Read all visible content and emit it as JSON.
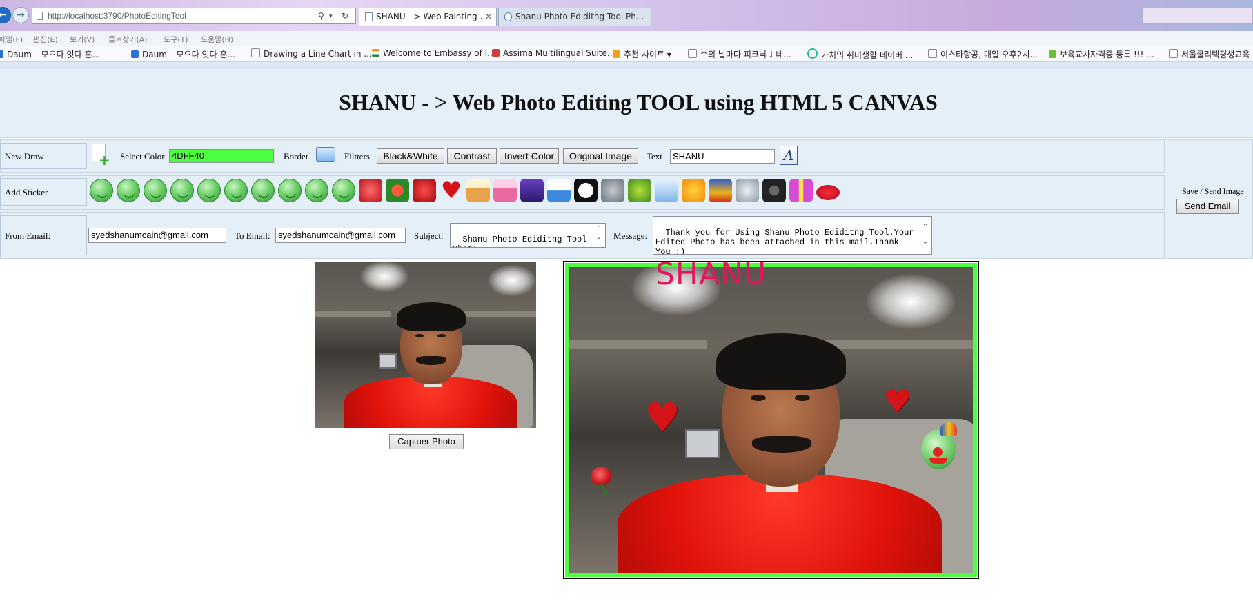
{
  "browser": {
    "address": "http://localhost:3790/PhotoEditingTool",
    "tabs": [
      {
        "label": "SHANU - > Web Painting ..."
      },
      {
        "label": "Shanu Photo Ediditng Tool Ph..."
      }
    ],
    "menu": [
      "파일(F)",
      "편집(E)",
      "보기(V)",
      "즐겨찾기(A)",
      "도구(T)",
      "도움말(H)"
    ],
    "favorites": [
      {
        "label": "Daum – 모으다 잇다 흔...",
        "icon_color": "#2f6fd6"
      },
      {
        "label": "Daum – 모으다 잇다 흔...",
        "icon_color": "#2f6fd6"
      },
      {
        "label": "Drawing a Line Chart in ...",
        "icon_color": "#8a8a8a"
      },
      {
        "label": "Welcome to Embassy of I...",
        "icon_color": "#f28c28"
      },
      {
        "label": "Assima Multilingual Suite...",
        "icon_color": "#d23b3b"
      },
      {
        "label": "추천 사이트 ▾",
        "icon_color": "#f0a020"
      },
      {
        "label": "수의 날마다 피크닉 ♩  네...",
        "icon_color": "#8a8a8a"
      },
      {
        "label": "가치의 취미생활  네이버 ...",
        "icon_color": "#1bbfa3"
      },
      {
        "label": "이스타항공, 매일 오후2시...",
        "icon_color": "#8a8a8a"
      },
      {
        "label": "보육교사자격증 등록 !!!  ...",
        "icon_color": "#6bbf3a"
      },
      {
        "label": "서울쿨리텍평생교육",
        "icon_color": "#8a8a8a"
      }
    ]
  },
  "page": {
    "title": "SHANU - > Web Photo Editing TOOL using HTML 5 CANVAS"
  },
  "toolbar": {
    "new_draw_label": "New Draw",
    "select_color_label": "Select Color",
    "color_value": "4DFF40",
    "selected_color": "#4dff40",
    "border_label": "Border",
    "filters_label": "Filtters",
    "filter_buttons": [
      "Black&White",
      "Contrast",
      "Invert Color",
      "Original Image"
    ],
    "text_label": "Text",
    "text_value": "SHANU",
    "add_sticker_label": "Add Sticker",
    "stickers": [
      "smiley-blush-icon",
      "smiley-love-icon",
      "smiley-party-icon",
      "smiley-kiss-icon",
      "smiley-tongue-icon",
      "smiley-pirate-icon",
      "smiley-grin-icon",
      "smiley-surprised-icon",
      "smiley-clown-icon",
      "smiley-sick-icon",
      "rose-icon",
      "flowers-icon",
      "red-rose-icon",
      "heart-icon",
      "cake-icon",
      "birthday-cake-icon",
      "wizard-hat-icon",
      "cap-icon",
      "panda-icon",
      "elephant-icon",
      "butterfly-icon",
      "dolphin-icon",
      "goldfish-icon",
      "parrot-icon",
      "wolf-icon",
      "motorcycle-icon",
      "gift-icon",
      "lips-icon"
    ],
    "from_email_label": "From Email:",
    "from_email": "syedshanumcain@gmail.com",
    "to_email_label": "To Email:",
    "to_email": "syedshanumcain@gmail.com",
    "subject_label": "Subject:",
    "subject": "Shanu Photo Ediditng Tool Photo",
    "message_label": "Message:",
    "message": "Thank you for Using Shanu Photo Ediditng Tool.Your Edited Photo has been attached in this mail.Thank You :)",
    "save_send_label": "Save / Send Image",
    "send_email_label": "Send Email"
  },
  "capture_button_label": "Captuer Photo",
  "canvas": {
    "overlay_text": "SHANU",
    "overlay_text_color": "#e2165f",
    "border_color": "#4dff40"
  }
}
